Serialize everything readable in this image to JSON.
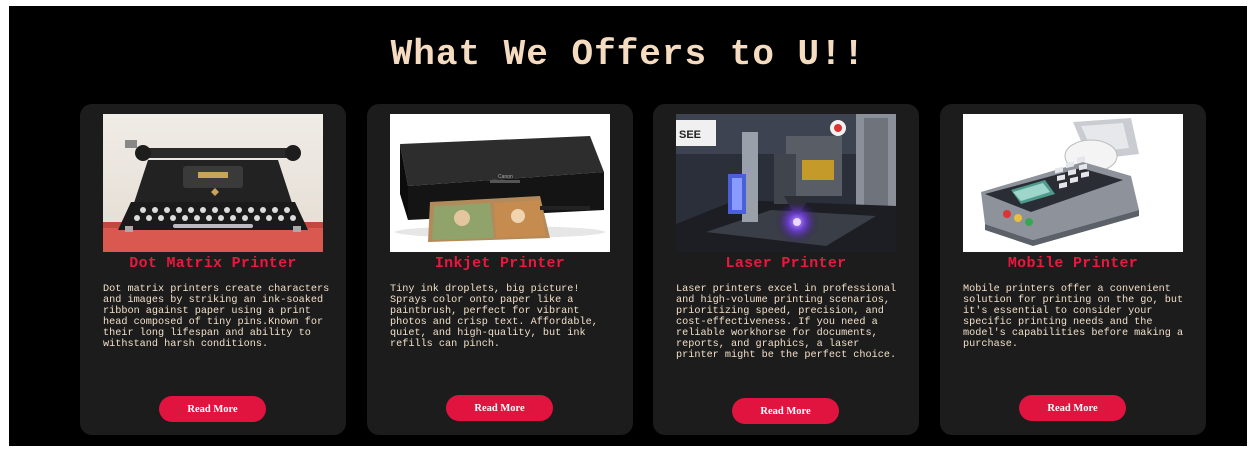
{
  "heading": "What We Offers to U!!",
  "cards": [
    {
      "title": "Dot Matrix Printer",
      "description": "Dot matrix printers create characters and images by striking an ink-soaked ribbon against paper using a print head composed of tiny pins.Known for their long lifespan and ability to withstand harsh conditions.",
      "button": "Read More",
      "image_icon": "typewriter-image"
    },
    {
      "title": "Inkjet Printer",
      "description": "Tiny ink droplets, big picture! Sprays color onto paper like a paintbrush, perfect for vibrant photos and crisp text. Affordable, quiet, and high-quality, but ink refills can pinch.",
      "button": "Read More",
      "image_icon": "inkjet-printer-image"
    },
    {
      "title": "Laser Printer",
      "description": "Laser printers excel in professional and high-volume printing scenarios, prioritizing speed, precision, and cost-effectiveness. If you need a reliable workhorse for documents, reports, and graphics, a laser printer might be the perfect choice.",
      "button": "Read More",
      "image_icon": "laser-printer-image"
    },
    {
      "title": "Mobile Printer",
      "description": "Mobile printers offer a convenient solution for printing on the go, but it's essential to consider your specific printing needs and the model's capabilities before making a purchase.",
      "button": "Read More",
      "image_icon": "mobile-printer-image"
    }
  ],
  "colors": {
    "background": "#000000",
    "card": "#1c1c1c",
    "heading": "#f5dcc0",
    "title": "#e8193f",
    "button": "#e0143f",
    "text": "#f2dfc8"
  }
}
